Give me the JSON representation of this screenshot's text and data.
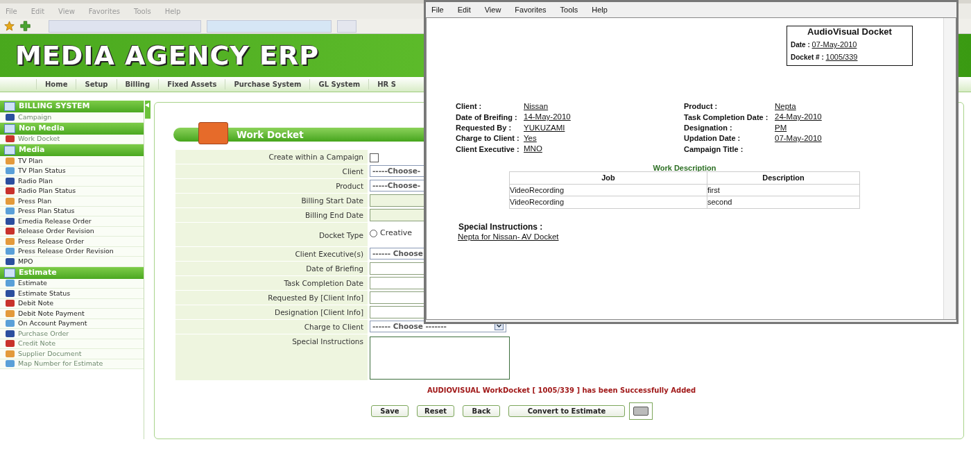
{
  "browser_menu": [
    "File",
    "Edit",
    "View",
    "Favorites",
    "Tools",
    "Help"
  ],
  "banner": {
    "title": "MEDIA AGENCY ERP"
  },
  "nav": [
    "Home",
    "Setup",
    "Billing",
    "Fixed Assets",
    "Purchase System",
    "GL System",
    "HR S"
  ],
  "sidebar": [
    {
      "header": "BILLING SYSTEM",
      "items": [
        {
          "label": "Campaign",
          "dimmed": true
        }
      ]
    },
    {
      "header": "Non Media",
      "items": [
        {
          "label": "Work Docket",
          "dimmed": true
        }
      ]
    },
    {
      "header": "Media",
      "items": [
        {
          "label": "TV Plan",
          "dimmed": false
        },
        {
          "label": "TV Plan Status",
          "dimmed": false
        },
        {
          "label": "Radio Plan",
          "dimmed": false
        },
        {
          "label": "Radio Plan Status",
          "dimmed": false
        },
        {
          "label": "Press Plan",
          "dimmed": false
        },
        {
          "label": "Press Plan Status",
          "dimmed": false
        },
        {
          "label": "Emedia Release Order",
          "dimmed": false
        },
        {
          "label": "Release Order Revision",
          "dimmed": false
        },
        {
          "label": "Press Release Order",
          "dimmed": false
        },
        {
          "label": "Press Release Order Revision",
          "dimmed": false
        },
        {
          "label": "MPO",
          "dimmed": false
        }
      ]
    },
    {
      "header": "Estimate",
      "items": [
        {
          "label": "Estimate",
          "dimmed": false
        },
        {
          "label": "Estimate Status",
          "dimmed": false
        },
        {
          "label": "Debit Note",
          "dimmed": false
        },
        {
          "label": "Debit Note Payment",
          "dimmed": false
        },
        {
          "label": "On Account Payment",
          "dimmed": false
        },
        {
          "label": "Purchase Order",
          "dimmed": true
        },
        {
          "label": "Credit Note",
          "dimmed": true
        },
        {
          "label": "Supplier Document",
          "dimmed": true
        },
        {
          "label": "Map Number for Estimate",
          "dimmed": true
        }
      ]
    }
  ],
  "form": {
    "title": "Work Docket",
    "rows": [
      {
        "label": "Create within a Campaign",
        "kind": "checkbox",
        "checked": false
      },
      {
        "label": "Client",
        "kind": "select",
        "value": "-----Choose-"
      },
      {
        "label": "Product",
        "kind": "select",
        "value": "-----Choose-"
      },
      {
        "label": "Billing Start Date",
        "kind": "text",
        "disabled": true
      },
      {
        "label": "Billing End Date",
        "kind": "text",
        "disabled": true
      },
      {
        "label": "Docket Type",
        "kind": "radio",
        "option": "Creative",
        "selected": false
      },
      {
        "label": "Client Executive(s)",
        "kind": "select",
        "value": "------ Choose"
      },
      {
        "label": "Date of Briefing",
        "kind": "text",
        "disabled": false
      },
      {
        "label": "Task Completion Date",
        "kind": "text",
        "disabled": false
      },
      {
        "label": "Requested By [Client Info]",
        "kind": "text",
        "disabled": false
      },
      {
        "label": "Designation [Client Info]",
        "kind": "text",
        "disabled": false
      },
      {
        "label": "Charge to Client",
        "kind": "dropdown",
        "value": "------ Choose -------"
      },
      {
        "label": "Special Instructions",
        "kind": "textarea"
      }
    ],
    "message": "AUDIOVISUAL WorkDocket [ 1005/339 ] has been Successfully Added",
    "buttons": [
      "Save",
      "Reset",
      "Back",
      "Convert to Estimate"
    ]
  },
  "popup": {
    "menu": [
      "File",
      "Edit",
      "View",
      "Favorites",
      "Tools",
      "Help"
    ],
    "docket": {
      "title": "AudioVisual Docket",
      "fields": [
        {
          "label": "Date :",
          "value": "07-May-2010"
        },
        {
          "label": "Docket # :",
          "value": "1005/339"
        }
      ]
    },
    "left_fields": [
      {
        "label": "Client :",
        "value": "Nissan"
      },
      {
        "label": "Date of Breifing :",
        "value": "14-May-2010"
      },
      {
        "label": "Requested By :",
        "value": "YUKUZAMI"
      },
      {
        "label": "Charge to Client :",
        "value": "Yes"
      },
      {
        "label": "Client Executive :",
        "value": "MNO"
      }
    ],
    "right_fields": [
      {
        "label": "Product :",
        "value": "Nepta"
      },
      {
        "label": "Task Completion Date :",
        "value": "24-May-2010"
      },
      {
        "label": "Designation :",
        "value": "PM"
      },
      {
        "label": "Updation Date :",
        "value": "07-May-2010"
      },
      {
        "label": "Campaign Title :"
      }
    ],
    "table": {
      "title": "Work Description",
      "columns": [
        "Job",
        "Description"
      ],
      "rows": [
        [
          "VideoRecording",
          "first"
        ],
        [
          "VideoRecording",
          "second"
        ]
      ]
    },
    "special": {
      "label": "Special Instructions :",
      "value": "Nepta for Nissan- AV Docket"
    }
  }
}
